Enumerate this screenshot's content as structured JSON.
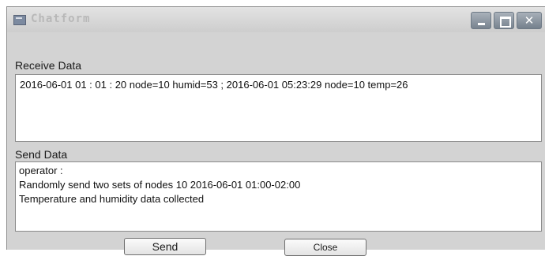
{
  "window": {
    "title": "Chatform"
  },
  "receive": {
    "label": "Receive Data",
    "text": "2016-06-01  01 : 01 : 20 node=10 humid=53 ; 2016-06-01 05:23:29 node=10 temp=26"
  },
  "send": {
    "label": "Send Data",
    "lines": [
      "operator :",
      "Randomly send two sets of nodes 10 2016-06-01 01:00-02:00",
      "Temperature and humidity data collected"
    ]
  },
  "buttons": {
    "send": "Send",
    "close": "Close"
  }
}
